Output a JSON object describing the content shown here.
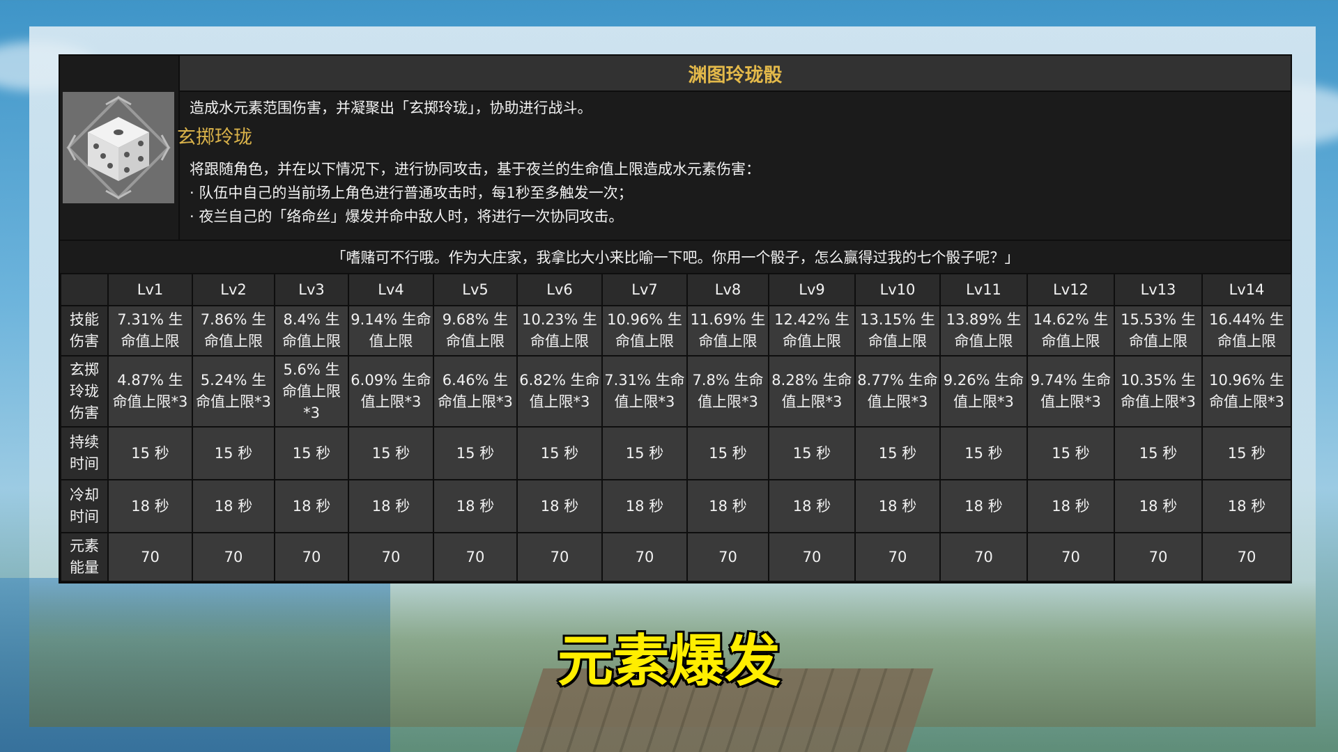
{
  "skill": {
    "name": "渊图玲珑骰",
    "description": "造成水元素范围伤害，并凝聚出「玄掷玲珑」，协助进行战斗。",
    "sub_title": "玄掷玲珑",
    "details": [
      "将跟随角色，并在以下情况下，进行协同攻击，基于夜兰的生命值上限造成水元素伤害：",
      "· 队伍中自己的当前场上角色进行普通攻击时，每1秒至多触发一次；",
      "· 夜兰自己的「络命丝」爆发并命中敌人时，将进行一次协同攻击。"
    ],
    "quote": "「嗜赌可不行哦。作为大庄家，我拿比大小来比喻一下吧。你用一个骰子，怎么赢得过我的七个骰子呢？」",
    "icon": "dice-icon"
  },
  "table": {
    "levels": [
      "Lv1",
      "Lv2",
      "Lv3",
      "Lv4",
      "Lv5",
      "Lv6",
      "Lv7",
      "Lv8",
      "Lv9",
      "Lv10",
      "Lv11",
      "Lv12",
      "Lv13",
      "Lv14"
    ],
    "rows": [
      {
        "label": "技能伤害",
        "values": [
          "7.31% 生命值上限",
          "7.86% 生命值上限",
          "8.4% 生命值上限",
          "9.14% 生命值上限",
          "9.68% 生命值上限",
          "10.23% 生命值上限",
          "10.96% 生命值上限",
          "11.69% 生命值上限",
          "12.42% 生命值上限",
          "13.15% 生命值上限",
          "13.89% 生命值上限",
          "14.62% 生命值上限",
          "15.53% 生命值上限",
          "16.44% 生命值上限"
        ]
      },
      {
        "label": "玄掷玲珑伤害",
        "values": [
          "4.87% 生命值上限*3",
          "5.24% 生命值上限*3",
          "5.6% 生命值上限*3",
          "6.09% 生命值上限*3",
          "6.46% 生命值上限*3",
          "6.82% 生命值上限*3",
          "7.31% 生命值上限*3",
          "7.8% 生命值上限*3",
          "8.28% 生命值上限*3",
          "8.77% 生命值上限*3",
          "9.26% 生命值上限*3",
          "9.74% 生命值上限*3",
          "10.35% 生命值上限*3",
          "10.96% 生命值上限*3"
        ]
      },
      {
        "label": "持续时间",
        "values": [
          "15 秒",
          "15 秒",
          "15 秒",
          "15 秒",
          "15 秒",
          "15 秒",
          "15 秒",
          "15 秒",
          "15 秒",
          "15 秒",
          "15 秒",
          "15 秒",
          "15 秒",
          "15 秒"
        ]
      },
      {
        "label": "冷却时间",
        "values": [
          "18 秒",
          "18 秒",
          "18 秒",
          "18 秒",
          "18 秒",
          "18 秒",
          "18 秒",
          "18 秒",
          "18 秒",
          "18 秒",
          "18 秒",
          "18 秒",
          "18 秒",
          "18 秒"
        ]
      },
      {
        "label": "元素能量",
        "values": [
          "70",
          "70",
          "70",
          "70",
          "70",
          "70",
          "70",
          "70",
          "70",
          "70",
          "70",
          "70",
          "70",
          "70"
        ]
      }
    ]
  },
  "caption": "元素爆发",
  "colors": {
    "title_gold": "#e3b94a",
    "subtitle_gold": "#d9b24a",
    "caption_yellow": "#ffee00"
  }
}
